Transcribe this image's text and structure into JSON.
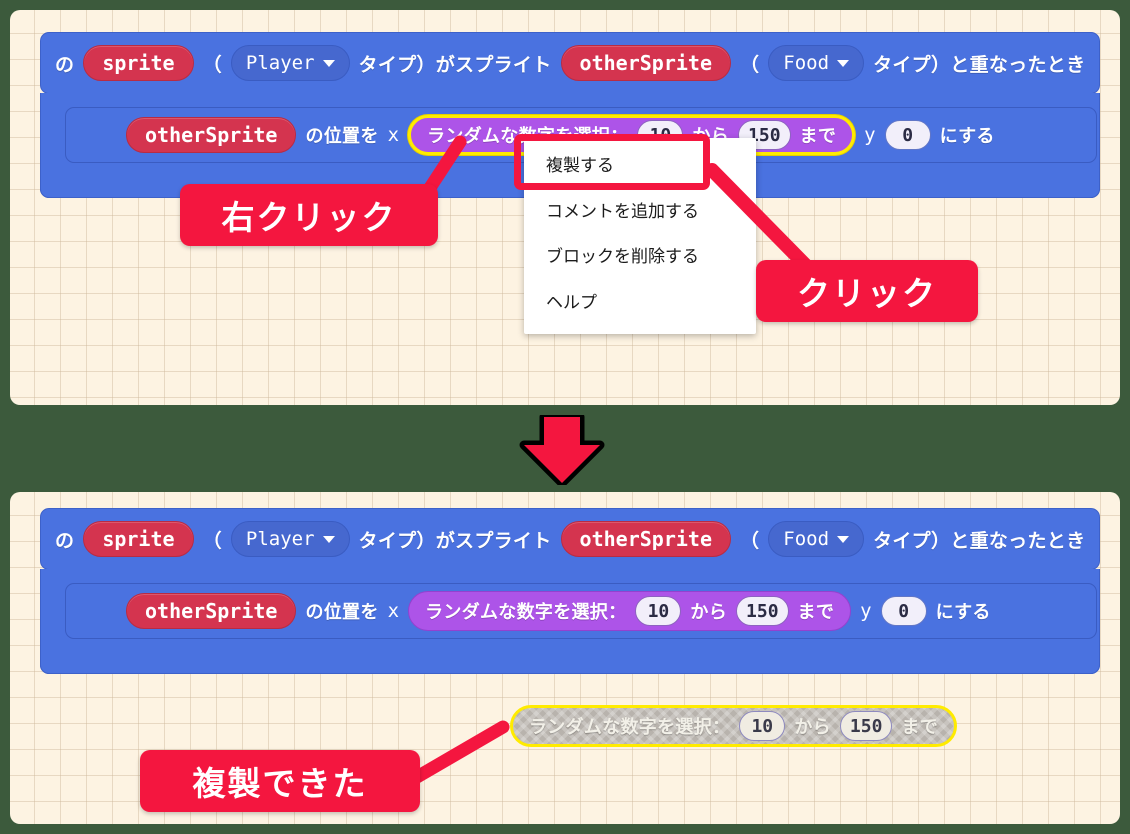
{
  "theme": {
    "canvas_bg": "#fdf3e2",
    "page_bg": "#3c5a3c",
    "event_block": "#4a72e0",
    "variable_pill": "#d4344f",
    "math_reporter": "#ad54e8",
    "highlight_outline": "#ffeb00",
    "callout_red": "#f4163f"
  },
  "blocks": {
    "event": {
      "prefix": "の",
      "sprite_var": "sprite",
      "paren_open_1": "（",
      "kind_1": "Player",
      "mid_1": "タイプ）がスプライト",
      "other_var": "otherSprite",
      "paren_open_2": "（",
      "kind_2": "Food",
      "suffix": "タイプ）と重なったとき",
      "dropdown_icon": "chevron-down-icon"
    },
    "statement": {
      "target_var": "otherSprite",
      "label_position": "の位置を",
      "axis_x": "x",
      "axis_y": "y",
      "y_value": "0",
      "tail": "にする"
    },
    "random_reporter": {
      "label": "ランダムな数字を選択：",
      "from_value": "10",
      "between": "から",
      "to_value": "150",
      "until": "まで"
    },
    "duplicated_reporter": {
      "label": "ランダムな数字を選択：",
      "from_value": "10",
      "between": "から",
      "to_value": "150",
      "until": "まで"
    }
  },
  "context_menu": {
    "items": [
      {
        "label": "複製する",
        "name": "duplicate"
      },
      {
        "label": "コメントを追加する",
        "name": "add-comment"
      },
      {
        "label": "ブロックを削除する",
        "name": "delete-block"
      },
      {
        "label": "ヘルプ",
        "name": "help"
      }
    ]
  },
  "callouts": {
    "right_click": "右クリック",
    "click": "クリック",
    "duplicated": "複製できた"
  },
  "flow": {
    "arrow_icon": "arrow-down-icon"
  }
}
